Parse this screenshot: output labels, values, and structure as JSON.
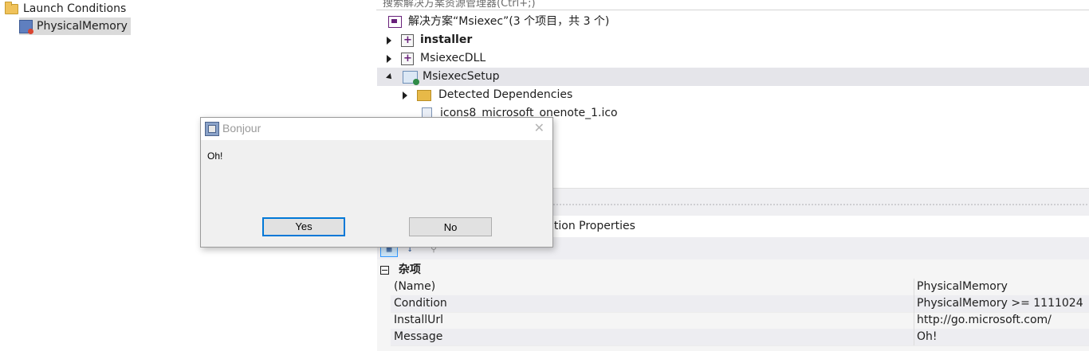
{
  "left_tree": {
    "root_label": "Launch Conditions",
    "child_label": "PhysicalMemory"
  },
  "solution_explorer": {
    "search_placeholder": "搜索解决方案资源管理器(Ctrl+;)",
    "solution_label": "解决方案“Msiexec”(3 个项目，共 3 个)",
    "items": [
      {
        "label": "installer",
        "bold": true
      },
      {
        "label": "MsiexecDLL"
      },
      {
        "label": "MsiexecSetup",
        "selected": true
      },
      {
        "label": "Detected Dependencies"
      },
      {
        "label": "icons8_microsoft_onenote_1.ico"
      }
    ]
  },
  "properties": {
    "header": "ition Properties",
    "category": "杂项",
    "rows": [
      {
        "name": "(Name)",
        "value": "PhysicalMemory"
      },
      {
        "name": "Condition",
        "value": "PhysicalMemory >= 1111024"
      },
      {
        "name": "InstallUrl",
        "value": "http://go.microsoft.com/"
      },
      {
        "name": "Message",
        "value": "Oh!"
      }
    ]
  },
  "dialog": {
    "title": "Bonjour",
    "message": "Oh!",
    "yes_label": "Yes",
    "no_label": "No",
    "close_glyph": "✕"
  },
  "icons": {
    "folder": "folder-icon",
    "condition": "launch-condition-icon",
    "project": "project-icon",
    "setup": "setup-project-icon",
    "solution": "solution-icon",
    "file": "file-icon",
    "app": "app-icon"
  }
}
